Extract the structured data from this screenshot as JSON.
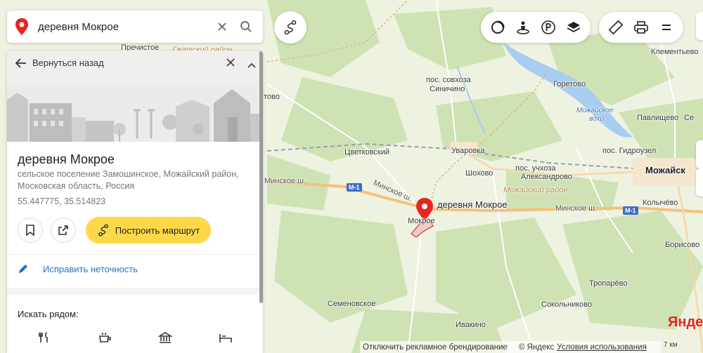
{
  "search": {
    "value": "деревня Мокрое"
  },
  "card": {
    "back_label": "Вернуться назад",
    "title": "деревня Мокрое",
    "address": "сельское поселение Замошинское, Можайский район, Московская область, Россия",
    "coordinates": "55.447775, 35.514823",
    "route_label": "Построить маршрут",
    "fix_label": "Исправить неточность",
    "nearby_label": "Искать рядом:"
  },
  "map": {
    "pin_label": "деревня Мокрое",
    "places": {
      "prechistoe": "Пречистое",
      "gzhatsky": "Гжатский район",
      "klementyevo": "Клементьево",
      "sovkhoz_1": "пос. совхоза",
      "sovkhoz_2": "Синичино",
      "goretovo": "Горетово",
      "reservoir_1": "Можайское",
      "reservoir_2": "вдхр.",
      "pavlishchevo": "Павлищево",
      "tsvetkovsky": "Цветковский",
      "uvarovka": "Уваровка",
      "gidrouzel": "пос. Гидроузел",
      "mozhaysk": "Можайск",
      "shokhovo": "Шохово",
      "uchkhoz_1": "пос. учхоза",
      "uchkhoz_2": "Александрово",
      "mozh_rayon": "Можайский район",
      "kolychevo": "Колычёво",
      "minsk_1": "Минское ш.",
      "minsk_2": "Минское ш.",
      "minsk_3": "Минское ш.",
      "m1_a": "М-1",
      "m1_b": "М-1",
      "mokroe": "Мокрое",
      "borisovo": "Борисово",
      "troparevo": "Тропарёво",
      "semenovskoe": "Семеновское",
      "sokolnikovo": "Сокольниково",
      "ivakino": "Ивакино",
      "tovo": "тово",
      "se": "Се"
    }
  },
  "footer": {
    "disable_ads": "Отключить рекламное брендирование",
    "copyright": "© Яндекс",
    "terms": "Условия использования",
    "brand": "Яндек",
    "scale": "7 км"
  },
  "colors": {
    "pin": "#e52620",
    "route_btn": "#ffd84a",
    "link": "#1e73c8",
    "road": "#f5c07a",
    "water": "#7aaee8"
  }
}
